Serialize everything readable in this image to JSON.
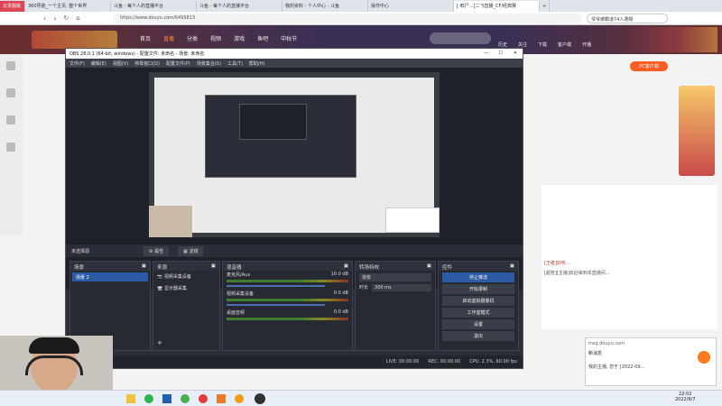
{
  "browser": {
    "tabs": [
      "360导航_一个主页, 整个世界",
      "斗鱼 - 每个人的直播平台",
      "斗鱼 - 每个人的直播平台",
      "我的资料 - 个人中心 - 斗鱼",
      "操作中心",
      "[-鲜尸...]二飞直播_CF/经典赛"
    ],
    "url": "https://www.douyu.com/6495813",
    "search_text": "爷爷被霸凌74人遭曝",
    "profile": "云贵服装"
  },
  "site": {
    "nav": [
      "首页",
      "直播",
      "分类",
      "视频",
      "游戏",
      "鱼吧",
      "中秋节"
    ],
    "search_placeholder": "",
    "nav_right": [
      "历史",
      "关注",
      "下载",
      "客户端",
      "开播"
    ],
    "live_btn": "PC客户端"
  },
  "obs": {
    "title": "OBS 28.0.1 (64-bit, windows) - 配置文件: 未命名 - 场景: 未命名",
    "menu": [
      "文件(F)",
      "编辑(E)",
      "视图(V)",
      "停靠窗口(D)",
      "配置文件(P)",
      "场景集合(S)",
      "工具(T)",
      "帮助(H)"
    ],
    "source_bar": [
      "未选择源",
      "属性",
      "滤镜"
    ],
    "panels": {
      "scenes": "场景",
      "sources": "来源",
      "mixer": "混音器",
      "transitions": "转场特效",
      "controls": "控件"
    },
    "scene_item": "场景 2",
    "sources": [
      "视频采集设备",
      "显示器采集"
    ],
    "mixer": [
      {
        "name": "麦克风/Aux",
        "level": "10.0 dB"
      },
      {
        "name": "视频采集设备",
        "level": "0.0 dB"
      },
      {
        "name": "桌面音频",
        "level": "0.0 dB"
      }
    ],
    "transition": {
      "type": "渐变",
      "duration_label": "时长",
      "duration": "300 ms"
    },
    "controls": [
      "停止推流",
      "开始录制",
      "启动虚拟摄像机",
      "工作室模式",
      "设置",
      "退出"
    ],
    "status": {
      "live": "LIVE: 00:00:00",
      "rec": "REC: 00:00:00",
      "cpu": "CPU: 2.3%, 60.00 fps"
    }
  },
  "chat": {
    "lines": [
      "[王者]好听…",
      "[超管][主播]欢迎来到本直播间…"
    ]
  },
  "notify": {
    "domain": "msg.douyu.com",
    "title": "新消息",
    "sub": "我的主播, 您于 [2022-09..."
  },
  "taskbar": {
    "time": "22:02",
    "date": "2022/9/7"
  }
}
